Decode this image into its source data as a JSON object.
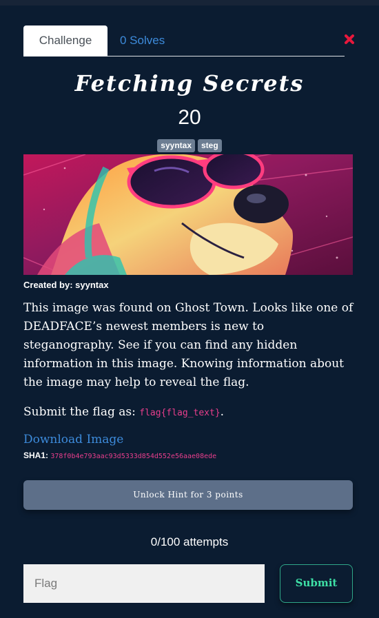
{
  "tabs": {
    "challenge": "Challenge",
    "solves": "0 Solves"
  },
  "challenge": {
    "title": "Fetching Secrets",
    "points": "20",
    "tags": [
      "syyntax",
      "steg"
    ],
    "created_by": "Created by: syyntax",
    "description": "This image was found on Ghost Town. Looks like one of DEADFACE’s newest members is new to steganography. See if you can find any hidden information in this image. Knowing information about the image may help to reveal the flag.",
    "submit_prefix": "Submit the flag as: ",
    "flag_format": "flag{flag_text}",
    "submit_suffix": ".",
    "download_label": "Download Image",
    "sha_label": "SHA1: ",
    "sha_value": "378f0b4e793aac93d5333d854d552e56aae08ede"
  },
  "hint_button": "Unlock Hint for 3 points",
  "attempts": "0/100 attempts",
  "flag_input": {
    "placeholder": "Flag",
    "value": ""
  },
  "submit_button": "Submit",
  "icons": {
    "close": "close-x-icon",
    "banner": "dog-with-sunglasses-illustration"
  },
  "colors": {
    "background": "#0b1c31",
    "link": "#3d8bdb",
    "code": "#e83e8c",
    "submit": "#3ee0a6",
    "close": "#e8183c"
  }
}
